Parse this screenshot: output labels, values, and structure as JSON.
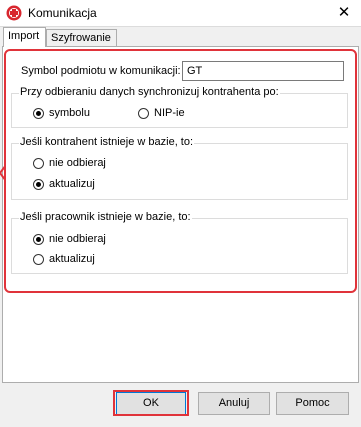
{
  "window": {
    "title": "Komunikacja",
    "app_icon": "app-logo-icon",
    "close_glyph": "✕"
  },
  "tabs": [
    {
      "label": "Import",
      "active": true
    },
    {
      "label": "Szyfrowanie",
      "active": false
    }
  ],
  "import_tab": {
    "symbol_label": "Symbol podmiotu w komunikacji:",
    "symbol_value": "GT",
    "sync_group": {
      "legend": "Przy odbieraniu danych synchronizuj kontrahenta po:",
      "options": [
        "symbolu",
        "NIP-ie"
      ],
      "selected": "symbolu"
    },
    "contractor_group": {
      "legend": "Jeśli kontrahent istnieje w bazie, to:",
      "options": [
        "nie odbieraj",
        "aktualizuj"
      ],
      "selected": "aktualizuj"
    },
    "employee_group": {
      "legend": "Jeśli pracownik istnieje w bazie, to:",
      "options": [
        "nie odbieraj",
        "aktualizuj"
      ],
      "selected": "nie odbieraj"
    }
  },
  "buttons": {
    "ok": "OK",
    "cancel": "Anuluj",
    "help": "Pomoc"
  },
  "colors": {
    "highlight": "#e0333a",
    "default_button_border": "#0078d7"
  }
}
